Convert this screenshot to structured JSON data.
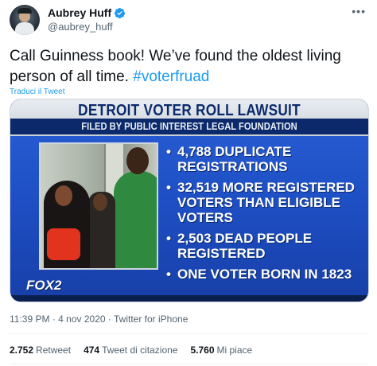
{
  "author": {
    "display_name": "Aubrey Huff",
    "handle": "@aubrey_huff",
    "verified": true,
    "more_icon": "more-dots-icon"
  },
  "tweet": {
    "text_main": "Call Guinness book! We’ve found the oldest living person of all time. ",
    "hashtag": "#voterfruad",
    "translate_label": "Traduci il Tweet"
  },
  "media": {
    "title": "DETROIT VOTER ROLL LAWSUIT",
    "subtitle": "FILED BY PUBLIC INTEREST LEGAL FOUNDATION",
    "bullets": [
      "4,788 DUPLICATE REGISTRATIONS",
      "32,519 MORE REGISTERED VOTERS THAN ELIGIBLE VOTERS",
      "2,503 DEAD PEOPLE REGISTERED",
      "ONE VOTER BORN IN 1823"
    ],
    "logo": "FOX2"
  },
  "meta": {
    "time": "11:39 PM",
    "date": "4 nov 2020",
    "separator": " · ",
    "source": "Twitter for iPhone"
  },
  "stats": {
    "retweets": "2.752",
    "retweets_label": "Retweet",
    "quotes": "474",
    "quotes_label": "Tweet di citazione",
    "likes": "5.760",
    "likes_label": "Mi piace"
  },
  "colors": {
    "accent": "#1d9bf0",
    "text": "#0f1419",
    "muted": "#536471",
    "graphic_blue": "#1e4fc4"
  }
}
